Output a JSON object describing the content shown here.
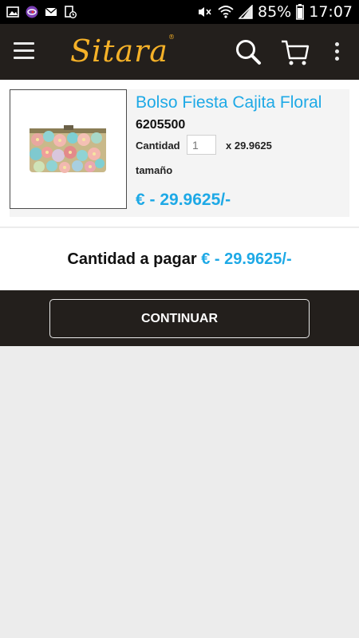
{
  "status_bar": {
    "battery": "85%",
    "time": "17:07"
  },
  "header": {
    "logo_text": "Sitara",
    "logo_reg": "®",
    "brand_color": "#f5b128"
  },
  "product": {
    "title": "Bolso Fiesta Cajita Floral",
    "code": "6205500",
    "quantity_label": "Cantidad",
    "quantity_value": "1",
    "unit_price": "x 29.9625",
    "size_label": "tamaño",
    "total": "€ - 29.9625/-"
  },
  "payment": {
    "label": "Cantidad a pagar",
    "value": "€ - 29.9625/-"
  },
  "actions": {
    "continue_label": "CONTINUAR"
  },
  "colors": {
    "accent": "#1ea9e6",
    "header_bg": "#231f1c",
    "page_bg": "#ececec"
  }
}
